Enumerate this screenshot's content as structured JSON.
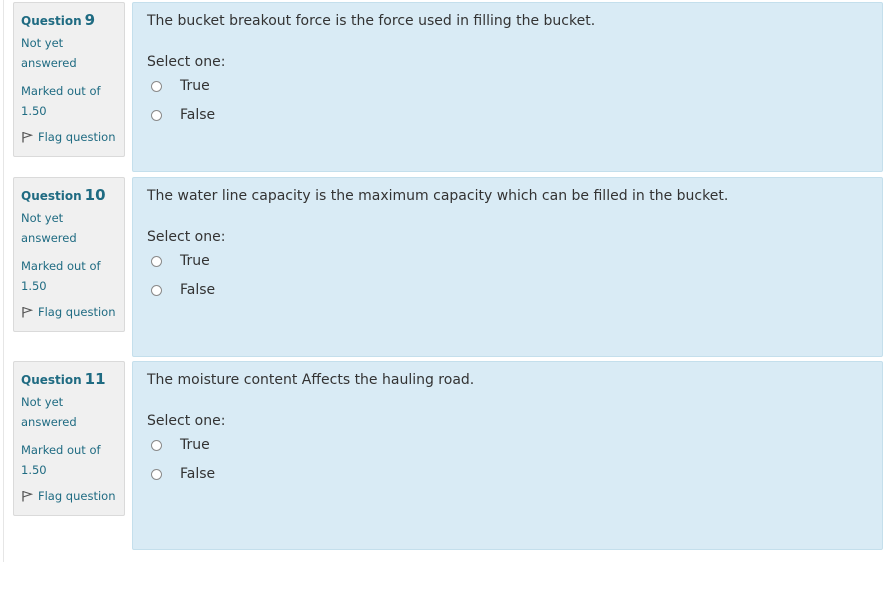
{
  "questions": [
    {
      "label": "Question",
      "number": "9",
      "state_line1": "Not yet",
      "state_line2": "answered",
      "grade_line1": "Marked out of",
      "grade_line2": "1.50",
      "flag_label": "Flag question",
      "text": "The bucket breakout force is the force used in filling the bucket.",
      "prompt": "Select one:",
      "options": [
        "True",
        "False"
      ]
    },
    {
      "label": "Question",
      "number": "10",
      "state_line1": "Not yet",
      "state_line2": "answered",
      "grade_line1": "Marked out of",
      "grade_line2": "1.50",
      "flag_label": "Flag question",
      "text": "The water line capacity is the maximum capacity which can be filled in the bucket.",
      "prompt": "Select one:",
      "options": [
        "True",
        "False"
      ]
    },
    {
      "label": "Question",
      "number": "11",
      "state_line1": "Not yet",
      "state_line2": "answered",
      "grade_line1": "Marked out of",
      "grade_line2": "1.50",
      "flag_label": "Flag question",
      "text": "The moisture content Affects the hauling road.",
      "prompt": "Select one:",
      "options": [
        "True",
        "False"
      ]
    }
  ]
}
